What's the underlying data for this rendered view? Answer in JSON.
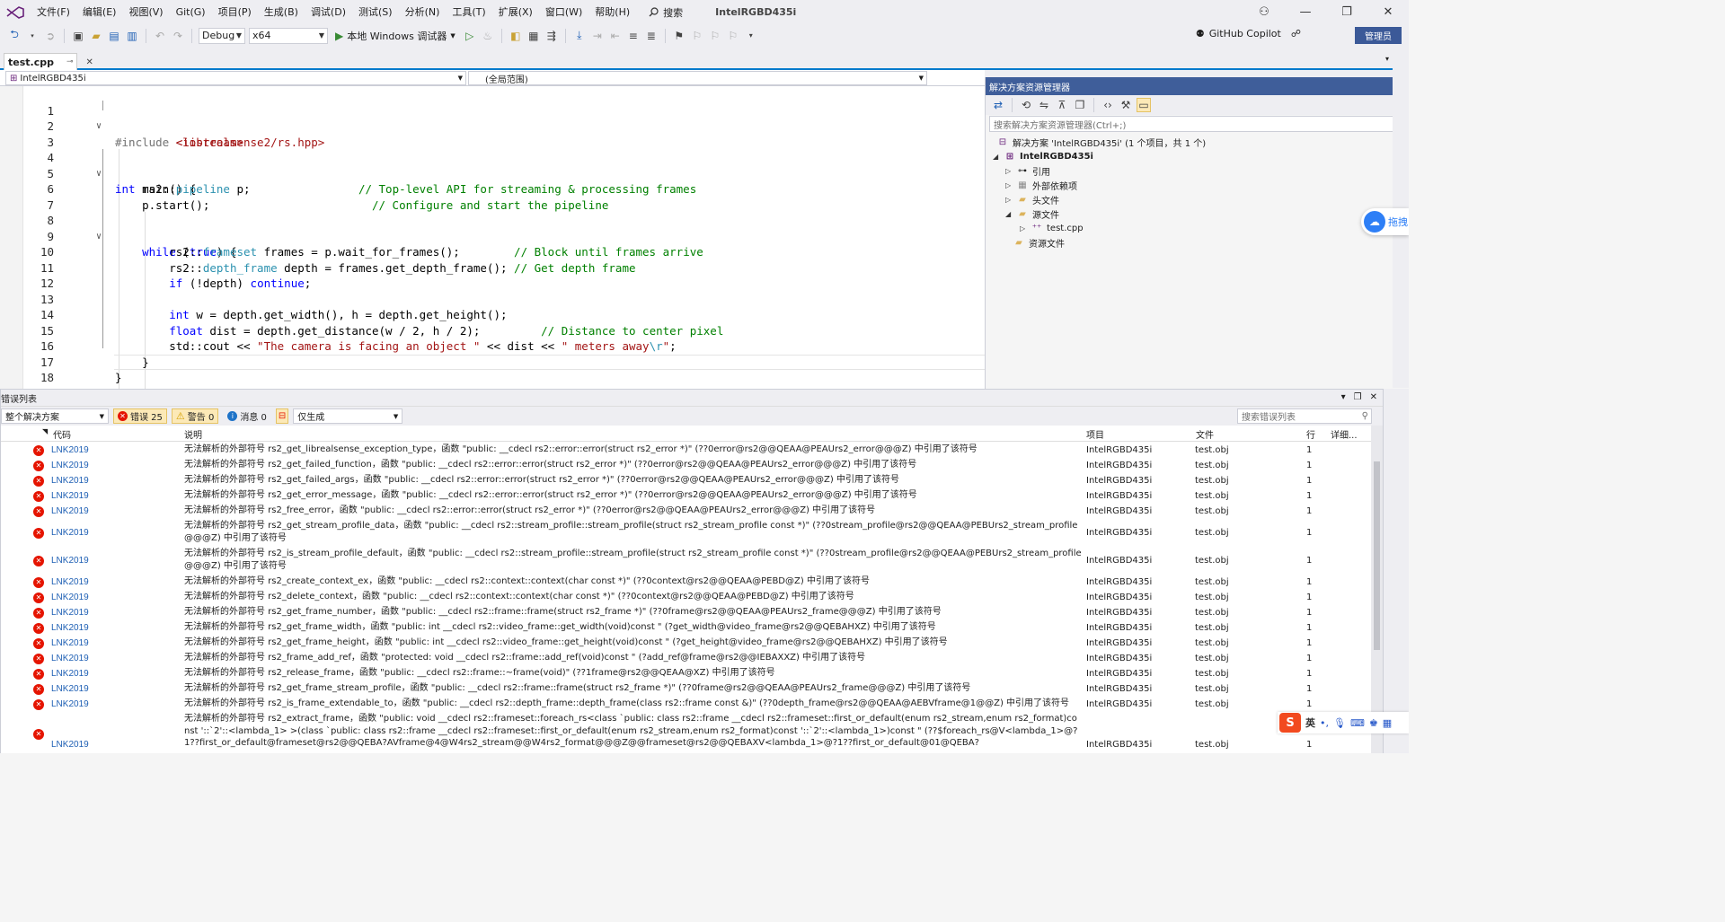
{
  "menu": {
    "items": [
      "文件(F)",
      "编辑(E)",
      "视图(V)",
      "Git(G)",
      "项目(P)",
      "生成(B)",
      "调试(D)",
      "测试(S)",
      "分析(N)",
      "工具(T)",
      "扩展(X)",
      "窗口(W)",
      "帮助(H)"
    ],
    "search_label": "搜索",
    "solution_name": "IntelRGBD435i"
  },
  "toolbar": {
    "config": "Debug",
    "platform": "x64",
    "run_label": "本地 Windows 调试器",
    "copilot_label": "GitHub Copilot",
    "admin_label": "管理员"
  },
  "editor": {
    "tab_label": "test.cpp",
    "nav_project": "IntelRGBD435i",
    "nav_scope": "(全局范围)",
    "line_numbers": [
      "1",
      "2",
      "3",
      "4",
      "5",
      "6",
      "7",
      "8",
      "9",
      "10",
      "11",
      "12",
      "13",
      "14",
      "15",
      "16",
      "17",
      "18"
    ]
  },
  "solution_explorer": {
    "title": "解决方案资源管理器",
    "search_placeholder": "搜索解决方案资源管理器(Ctrl+;)",
    "solution_label": "解决方案 'IntelRGBD435i' (1 个项目，共 1 个)",
    "project_label": "IntelRGBD435i",
    "nodes": [
      "引用",
      "外部依赖项",
      "头文件",
      "源文件",
      "test.cpp",
      "资源文件"
    ]
  },
  "floater": {
    "label": "拖拽"
  },
  "error_list": {
    "title": "错误列表",
    "scope": "整个解决方案",
    "errors_label": "错误 25",
    "warnings_label": "警告 0",
    "messages_label": "消息 0",
    "filter": "仅生成",
    "search_placeholder": "搜索错误列表",
    "columns": {
      "code": "代码",
      "desc": "说明",
      "project": "项目",
      "file": "文件",
      "line": "行",
      "detail": "详细..."
    },
    "rows": [
      {
        "code": "LNK2019",
        "desc": "无法解析的外部符号 rs2_get_librealsense_exception_type，函数 \"public: __cdecl rs2::error::error(struct rs2_error *)\" (??0error@rs2@@QEAA@PEAUrs2_error@@@Z) 中引用了该符号",
        "project": "IntelRGBD435i",
        "file": "test.obj",
        "line": "1"
      },
      {
        "code": "LNK2019",
        "desc": "无法解析的外部符号 rs2_get_failed_function，函数 \"public: __cdecl rs2::error::error(struct rs2_error *)\" (??0error@rs2@@QEAA@PEAUrs2_error@@@Z) 中引用了该符号",
        "project": "IntelRGBD435i",
        "file": "test.obj",
        "line": "1"
      },
      {
        "code": "LNK2019",
        "desc": "无法解析的外部符号 rs2_get_failed_args，函数 \"public: __cdecl rs2::error::error(struct rs2_error *)\" (??0error@rs2@@QEAA@PEAUrs2_error@@@Z) 中引用了该符号",
        "project": "IntelRGBD435i",
        "file": "test.obj",
        "line": "1"
      },
      {
        "code": "LNK2019",
        "desc": "无法解析的外部符号 rs2_get_error_message，函数 \"public: __cdecl rs2::error::error(struct rs2_error *)\" (??0error@rs2@@QEAA@PEAUrs2_error@@@Z) 中引用了该符号",
        "project": "IntelRGBD435i",
        "file": "test.obj",
        "line": "1"
      },
      {
        "code": "LNK2019",
        "desc": "无法解析的外部符号 rs2_free_error，函数 \"public: __cdecl rs2::error::error(struct rs2_error *)\" (??0error@rs2@@QEAA@PEAUrs2_error@@@Z) 中引用了该符号",
        "project": "IntelRGBD435i",
        "file": "test.obj",
        "line": "1"
      },
      {
        "code": "LNK2019",
        "desc": "无法解析的外部符号 rs2_get_stream_profile_data，函数 \"public: __cdecl rs2::stream_profile::stream_profile(struct rs2_stream_profile const *)\" (??0stream_profile@rs2@@QEAA@PEBUrs2_stream_profile@@@Z) 中引用了该符号",
        "project": "IntelRGBD435i",
        "file": "test.obj",
        "line": "1"
      },
      {
        "code": "LNK2019",
        "desc": "无法解析的外部符号 rs2_is_stream_profile_default，函数 \"public: __cdecl rs2::stream_profile::stream_profile(struct rs2_stream_profile const *)\" (??0stream_profile@rs2@@QEAA@PEBUrs2_stream_profile@@@Z) 中引用了该符号",
        "project": "IntelRGBD435i",
        "file": "test.obj",
        "line": "1"
      },
      {
        "code": "LNK2019",
        "desc": "无法解析的外部符号 rs2_create_context_ex，函数 \"public: __cdecl rs2::context::context(char const *)\" (??0context@rs2@@QEAA@PEBD@Z) 中引用了该符号",
        "project": "IntelRGBD435i",
        "file": "test.obj",
        "line": "1"
      },
      {
        "code": "LNK2019",
        "desc": "无法解析的外部符号 rs2_delete_context，函数 \"public: __cdecl rs2::context::context(char const *)\" (??0context@rs2@@QEAA@PEBD@Z) 中引用了该符号",
        "project": "IntelRGBD435i",
        "file": "test.obj",
        "line": "1"
      },
      {
        "code": "LNK2019",
        "desc": "无法解析的外部符号 rs2_get_frame_number，函数 \"public: __cdecl rs2::frame::frame(struct rs2_frame *)\" (??0frame@rs2@@QEAA@PEAUrs2_frame@@@Z) 中引用了该符号",
        "project": "IntelRGBD435i",
        "file": "test.obj",
        "line": "1"
      },
      {
        "code": "LNK2019",
        "desc": "无法解析的外部符号 rs2_get_frame_width，函数 \"public: int __cdecl rs2::video_frame::get_width(void)const \" (?get_width@video_frame@rs2@@QEBAHXZ) 中引用了该符号",
        "project": "IntelRGBD435i",
        "file": "test.obj",
        "line": "1"
      },
      {
        "code": "LNK2019",
        "desc": "无法解析的外部符号 rs2_get_frame_height，函数 \"public: int __cdecl rs2::video_frame::get_height(void)const \" (?get_height@video_frame@rs2@@QEBAHXZ) 中引用了该符号",
        "project": "IntelRGBD435i",
        "file": "test.obj",
        "line": "1"
      },
      {
        "code": "LNK2019",
        "desc": "无法解析的外部符号 rs2_frame_add_ref，函数 \"protected: void __cdecl rs2::frame::add_ref(void)const \" (?add_ref@frame@rs2@@IEBAXXZ) 中引用了该符号",
        "project": "IntelRGBD435i",
        "file": "test.obj",
        "line": "1"
      },
      {
        "code": "LNK2019",
        "desc": "无法解析的外部符号 rs2_release_frame，函数 \"public: __cdecl rs2::frame::~frame(void)\" (??1frame@rs2@@QEAA@XZ) 中引用了该符号",
        "project": "IntelRGBD435i",
        "file": "test.obj",
        "line": "1"
      },
      {
        "code": "LNK2019",
        "desc": "无法解析的外部符号 rs2_get_frame_stream_profile，函数 \"public: __cdecl rs2::frame::frame(struct rs2_frame *)\" (??0frame@rs2@@QEAA@PEAUrs2_frame@@@Z) 中引用了该符号",
        "project": "IntelRGBD435i",
        "file": "test.obj",
        "line": "1"
      },
      {
        "code": "LNK2019",
        "desc": "无法解析的外部符号 rs2_is_frame_extendable_to，函数 \"public: __cdecl rs2::depth_frame::depth_frame(class rs2::frame const &)\" (??0depth_frame@rs2@@QEAA@AEBVframe@1@@Z) 中引用了该符号",
        "project": "IntelRGBD435i",
        "file": "test.obj",
        "line": "1"
      },
      {
        "code": "LNK2019",
        "desc": "无法解析的外部符号 rs2_extract_frame，函数 \"public: void __cdecl rs2::frameset::foreach_rs<class `public: class rs2::frame __cdecl rs2::frameset::first_or_default(enum rs2_stream,enum rs2_format)const '::`2'::<lambda_1> >(class `public: class rs2::frame __cdecl rs2::frameset::first_or_default(enum rs2_stream,enum rs2_format)const '::`2'::<lambda_1>)const \" (??$foreach_rs@V<lambda_1>@?1??first_or_default@frameset@rs2@@QEBA?AVframe@4@W4rs2_stream@@W4rs2_format@@@Z@@frameset@rs2@@QEBAXV<lambda_1>@?1??first_or_default@01@QEBA?",
        "project": "IntelRGBD435i",
        "file": "test.obj",
        "line": "1"
      }
    ]
  },
  "ime": {
    "logo": "S",
    "lang": "英"
  }
}
